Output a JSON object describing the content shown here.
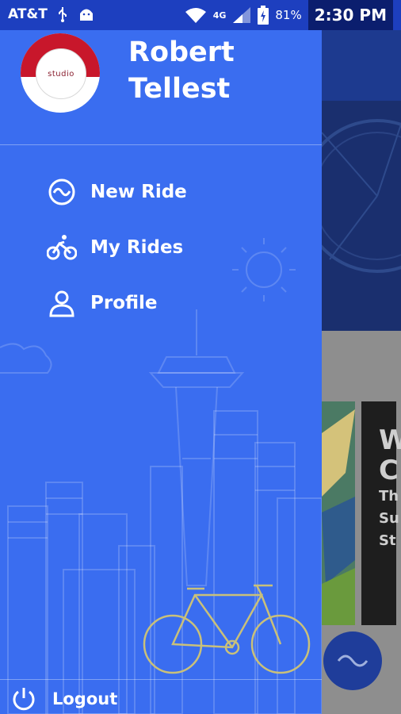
{
  "status_bar": {
    "carrier": "AT&T",
    "network": "4G",
    "battery": "81%",
    "time": "2:30 PM"
  },
  "drawer": {
    "user_name_line1": "Robert",
    "user_name_line2": "Tellest",
    "avatar_logo": "studio",
    "menu": [
      {
        "label": "New Ride",
        "icon": "new-ride-icon"
      },
      {
        "label": "My Rides",
        "icon": "bicycle-rider-icon"
      },
      {
        "label": "Profile",
        "icon": "person-icon"
      }
    ],
    "logout_label": "Logout"
  },
  "background_app": {
    "card_title_partial": "W\nC",
    "card_text_partial": [
      "Th",
      "Su",
      "St"
    ]
  },
  "colors": {
    "drawer_bg": "#3a6df0",
    "status_bar": "#1d3fbf",
    "avatar_red": "#c8172b"
  }
}
